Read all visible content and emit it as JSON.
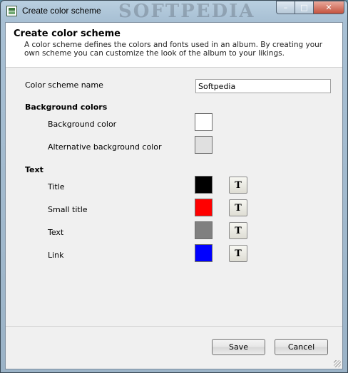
{
  "window": {
    "title": "Create color scheme",
    "watermark": "SOFTPEDIA",
    "close_glyph": "✕",
    "min_glyph": "–",
    "max_glyph": "□"
  },
  "header": {
    "title": "Create color scheme",
    "description": "A color scheme defines the colors and fonts used in an album. By creating your own scheme you can customize the look of the album to your likings."
  },
  "form": {
    "scheme_name_label": "Color scheme name",
    "scheme_name_value": "Softpedia",
    "background_section": "Background colors",
    "background_items": [
      {
        "label": "Background color",
        "color": "#ffffff"
      },
      {
        "label": "Alternative background color",
        "color": "#e0e0e0"
      }
    ],
    "text_section": "Text",
    "text_items": [
      {
        "label": "Title",
        "color": "#000000",
        "font_button": "T"
      },
      {
        "label": "Small title",
        "color": "#ff0000",
        "font_button": "T"
      },
      {
        "label": "Text",
        "color": "#808080",
        "font_button": "T"
      },
      {
        "label": "Link",
        "color": "#0000ff",
        "font_button": "T"
      }
    ]
  },
  "footer": {
    "save_label": "Save",
    "cancel_label": "Cancel"
  }
}
